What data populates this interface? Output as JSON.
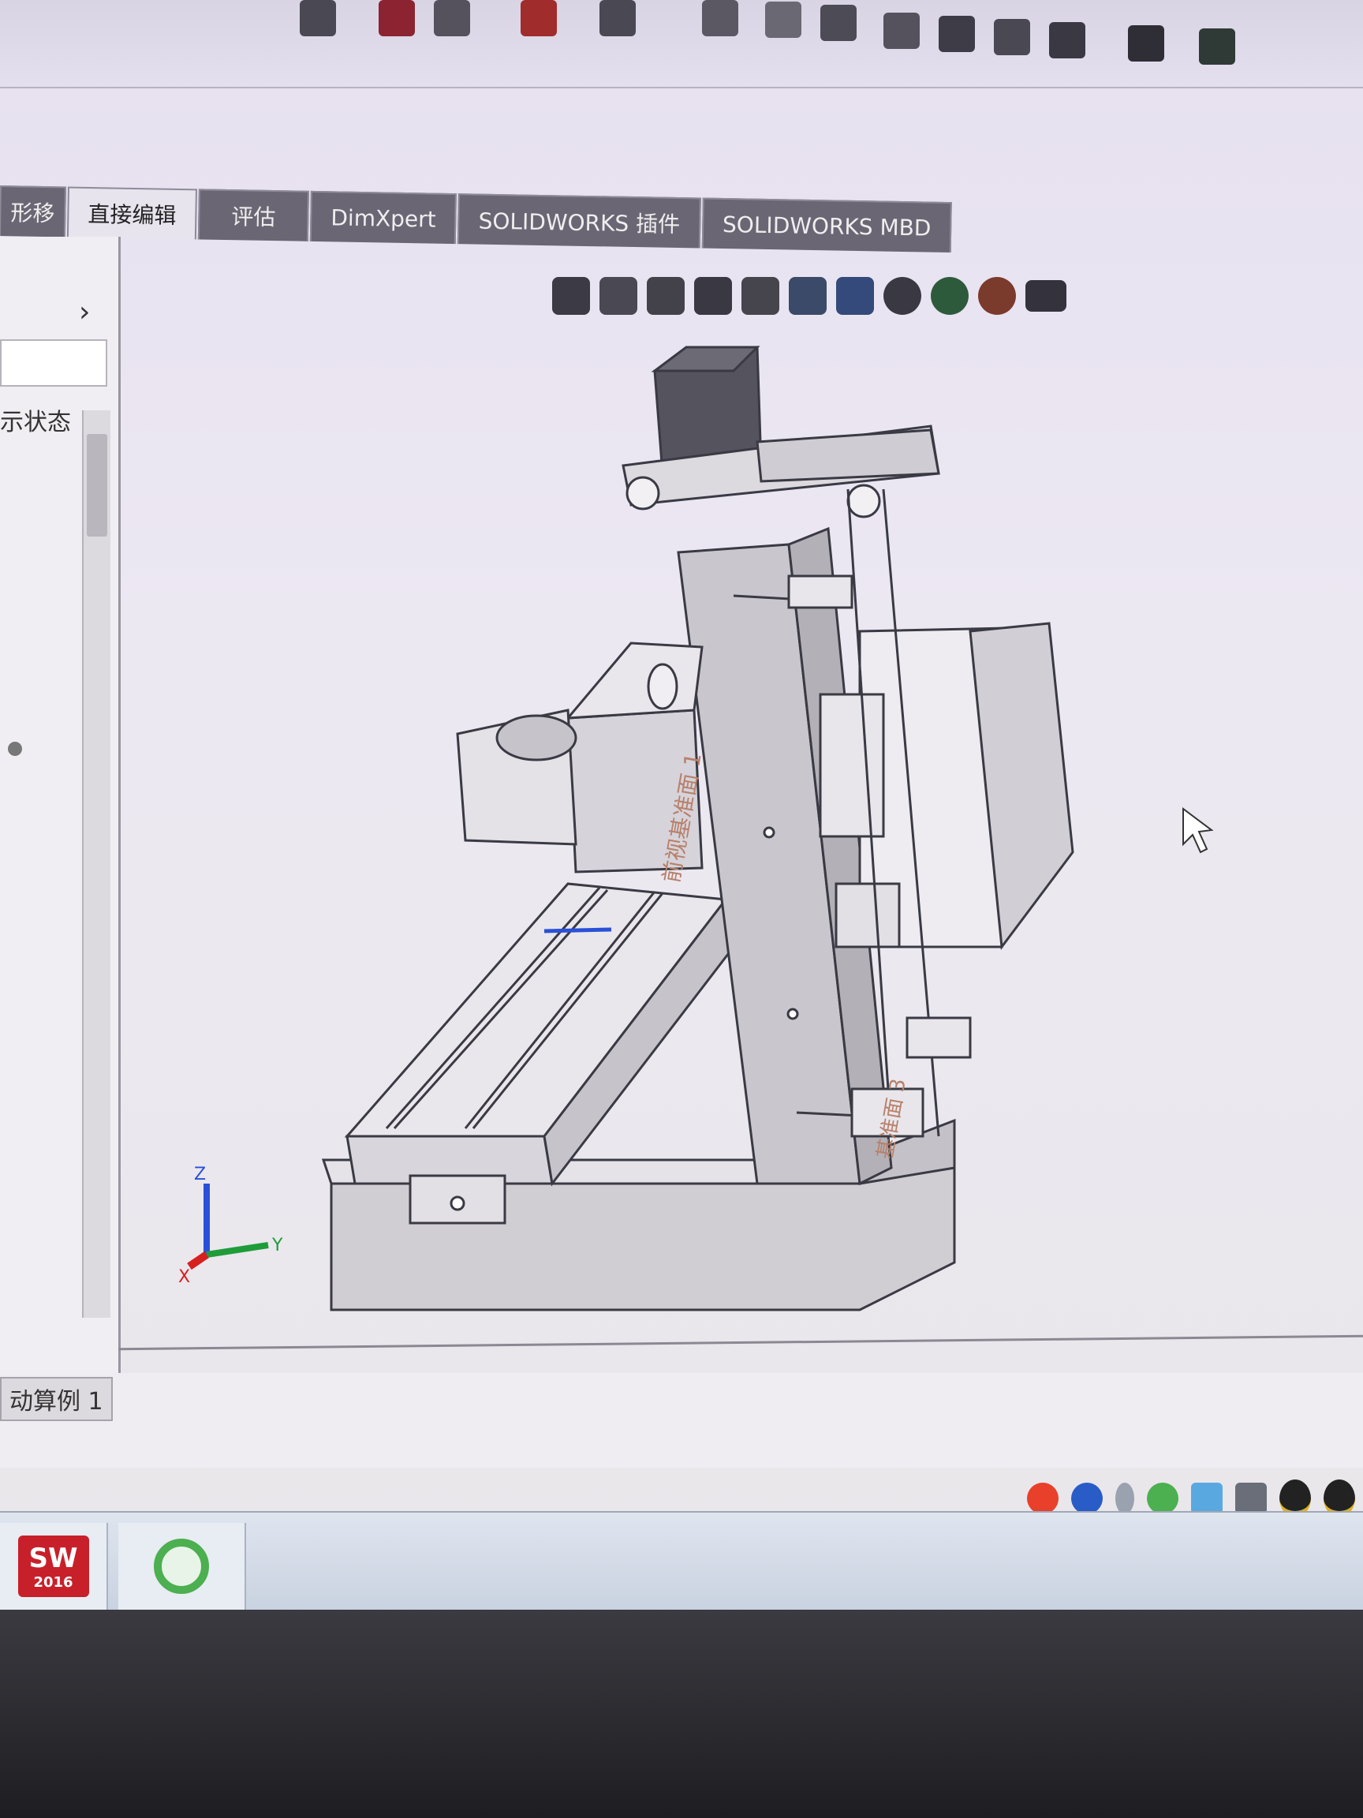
{
  "ribbon_tabs": [
    {
      "label": "形移"
    },
    {
      "label": "直接编辑"
    },
    {
      "label": "评估"
    },
    {
      "label": "DimXpert"
    },
    {
      "label": "SOLIDWORKS 插件"
    },
    {
      "label": "SOLIDWORKS MBD"
    }
  ],
  "left_panel": {
    "display_state_label": "示状态"
  },
  "status_bar": {
    "motion_study_tab": "动算例 1"
  },
  "viewport": {
    "axis_labels": {
      "x": "X",
      "y": "Y",
      "z": "Z"
    },
    "annotation_1": "前视基准面 1",
    "annotation_2": "基准面 3"
  },
  "taskbar": {
    "solidworks_logo_text": "SW",
    "solidworks_version": "2016"
  },
  "colors": {
    "accent_red": "#c8202a",
    "ie_green": "#4caf50",
    "axis_x": "#d62020",
    "axis_y": "#1f9c3a",
    "axis_z": "#2a50d8"
  },
  "icons": {
    "top_toolbar": [
      "zoom-to-fit-icon",
      "zoom-area-icon",
      "previous-view-icon",
      "section-view-icon",
      "view-orientation-icon",
      "display-style-icon",
      "hide-show-icon",
      "edit-appearance-icon",
      "apply-scene-icon"
    ],
    "view_toolbar": [
      "zoom-to-fit-icon",
      "zoom-area-icon",
      "previous-view-icon",
      "section-view-icon",
      "dynamic-annotation-icon",
      "view-orientation-icon",
      "display-style-icon",
      "hide-show-icon",
      "edit-appearance-icon",
      "apply-scene-icon",
      "view-settings-icon"
    ],
    "tray": [
      "sogou-ime-icon",
      "help-icon",
      "tray-arrow-icon",
      "browser-icon",
      "network-icon",
      "usb-icon",
      "qq-icon",
      "qq-icon-2"
    ]
  }
}
